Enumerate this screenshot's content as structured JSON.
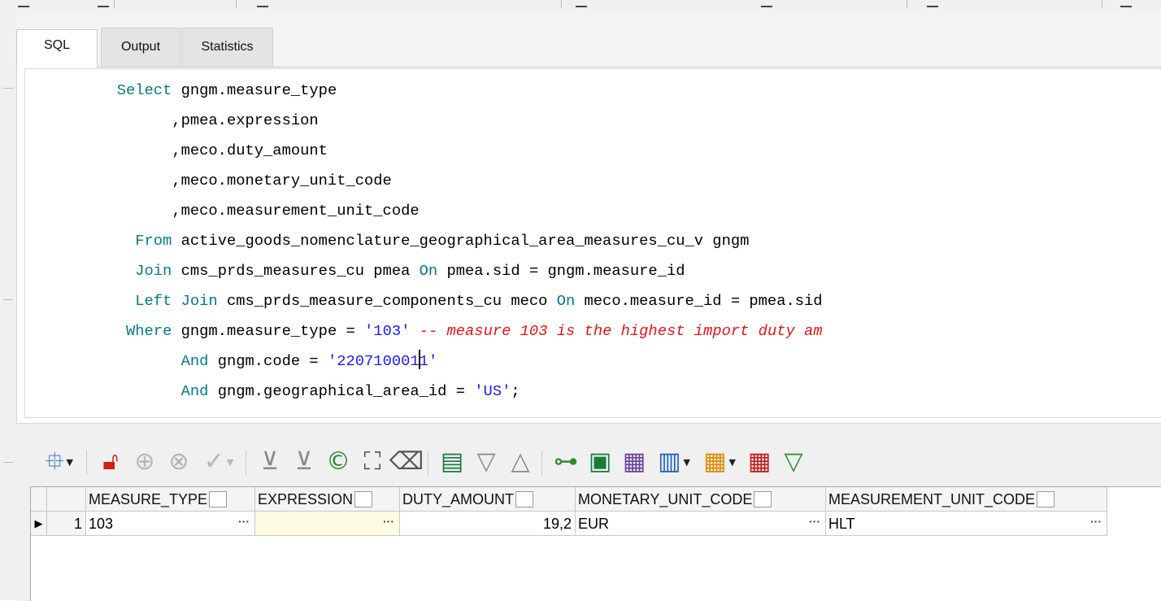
{
  "tabs": [
    {
      "label": "SQL",
      "active": true
    },
    {
      "label": "Output",
      "active": false
    },
    {
      "label": "Statistics",
      "active": false
    }
  ],
  "editor": {
    "lines": [
      [
        {
          "t": "          "
        },
        {
          "t": "Select",
          "k": "kw"
        },
        {
          "t": " gngm.measure_type"
        }
      ],
      [
        {
          "t": "                ,pmea.expression"
        }
      ],
      [
        {
          "t": "                ,meco.duty_amount"
        }
      ],
      [
        {
          "t": "                ,meco.monetary_unit_code"
        }
      ],
      [
        {
          "t": "                ,meco.measurement_unit_code"
        }
      ],
      [
        {
          "t": "            "
        },
        {
          "t": "From",
          "k": "kw"
        },
        {
          "t": " active_goods_nomenclature_geographical_area_measures_cu_v gngm"
        }
      ],
      [
        {
          "t": "            "
        },
        {
          "t": "Join",
          "k": "kw"
        },
        {
          "t": " cms_prds_measures_cu pmea "
        },
        {
          "t": "On",
          "k": "kw"
        },
        {
          "t": " pmea.sid = gngm.measure_id"
        }
      ],
      [
        {
          "t": "            "
        },
        {
          "t": "Left Join",
          "k": "kw"
        },
        {
          "t": " cms_prds_measure_components_cu meco "
        },
        {
          "t": "On",
          "k": "kw"
        },
        {
          "t": " meco.measure_id = pmea.sid"
        }
      ],
      [
        {
          "t": "           "
        },
        {
          "t": "Where",
          "k": "kw"
        },
        {
          "t": " gngm.measure_type = "
        },
        {
          "t": "'103'",
          "k": "str"
        },
        {
          "t": " "
        },
        {
          "t": "-- measure 103 is the highest import duty am",
          "k": "cm"
        }
      ],
      [
        {
          "t": "                 "
        },
        {
          "t": "And",
          "k": "kw"
        },
        {
          "t": " gngm.code = "
        },
        {
          "t": "'220710001",
          "k": "str"
        },
        {
          "caret": true
        },
        {
          "t": "1'",
          "k": "str"
        }
      ],
      [
        {
          "t": "                 "
        },
        {
          "t": "And",
          "k": "kw"
        },
        {
          "t": " gngm.geographical_area_id = "
        },
        {
          "t": "'US'",
          "k": "str"
        },
        {
          "t": ";"
        }
      ]
    ]
  },
  "toolbar": {
    "icons": [
      {
        "name": "column-layout-icon",
        "glyph": "⯐",
        "color": "#1f6fd1",
        "dropdown": true,
        "enabled": true
      },
      {
        "sep": true
      },
      {
        "name": "lock-icon",
        "glyph": "🔓︎",
        "color": "#d61b1b",
        "dropdown": false,
        "enabled": true
      },
      {
        "name": "add-record-icon",
        "glyph": "⊕",
        "color": "#b5b5b5",
        "dropdown": false,
        "enabled": false
      },
      {
        "name": "delete-record-icon",
        "glyph": "⊗",
        "color": "#b5b5b5",
        "dropdown": false,
        "enabled": false
      },
      {
        "name": "post-changes-icon",
        "glyph": "✓",
        "color": "#b5b5b5",
        "dropdown": true,
        "enabled": false
      },
      {
        "sep": true
      },
      {
        "name": "fetch-next-icon",
        "glyph": "⊻",
        "color": "#8a8a8a",
        "dropdown": false,
        "enabled": true
      },
      {
        "name": "fetch-all-icon",
        "glyph": "⊻",
        "color": "#8a8a8a",
        "dropdown": false,
        "enabled": true
      },
      {
        "name": "refresh-icon",
        "glyph": "©",
        "color": "#2e8b2e",
        "dropdown": false,
        "enabled": true
      },
      {
        "name": "find-icon",
        "glyph": "⛶",
        "color": "#444444",
        "dropdown": false,
        "enabled": true
      },
      {
        "name": "clear-icon",
        "glyph": "⌫",
        "color": "#555555",
        "dropdown": false,
        "enabled": true
      },
      {
        "sep": true
      },
      {
        "name": "single-record-view-icon",
        "glyph": "▤",
        "color": "#1a7a3a",
        "dropdown": false,
        "enabled": true
      },
      {
        "name": "sort-descending-icon",
        "glyph": "▽",
        "color": "#8a8a8a",
        "dropdown": false,
        "enabled": true
      },
      {
        "name": "sort-ascending-icon",
        "glyph": "△",
        "color": "#8a8a8a",
        "dropdown": false,
        "enabled": true
      },
      {
        "sep": true
      },
      {
        "name": "tree-view-icon",
        "glyph": "⊶",
        "color": "#2e8b2e",
        "dropdown": false,
        "enabled": true
      },
      {
        "name": "copy-text-icon",
        "glyph": "▣",
        "color": "#1a7a3a",
        "dropdown": false,
        "enabled": true
      },
      {
        "name": "export-icon",
        "glyph": "▦",
        "color": "#6a3ea1",
        "dropdown": false,
        "enabled": true
      },
      {
        "name": "chart-icon",
        "glyph": "▥",
        "color": "#1a5fc4",
        "dropdown": true,
        "enabled": true
      },
      {
        "name": "pivot-icon",
        "glyph": "▦",
        "color": "#e08a00",
        "dropdown": true,
        "enabled": true
      },
      {
        "name": "grid-icon",
        "glyph": "▦",
        "color": "#c41a1a",
        "dropdown": false,
        "enabled": true
      },
      {
        "name": "filter-icon",
        "glyph": "▽",
        "color": "#2e8b2e",
        "dropdown": false,
        "enabled": true
      }
    ]
  },
  "results": {
    "columns": [
      "MEASURE_TYPE",
      "EXPRESSION",
      "DUTY_AMOUNT",
      "MONETARY_UNIT_CODE",
      "MEASUREMENT_UNIT_CODE"
    ],
    "rows": [
      {
        "num": "1",
        "measure_type": "103",
        "expression": "",
        "duty_amount": "19,2",
        "monetary_unit_code": "EUR",
        "measurement_unit_code": "HLT"
      }
    ],
    "ellipsis": "···",
    "row_indicator": "▶"
  }
}
